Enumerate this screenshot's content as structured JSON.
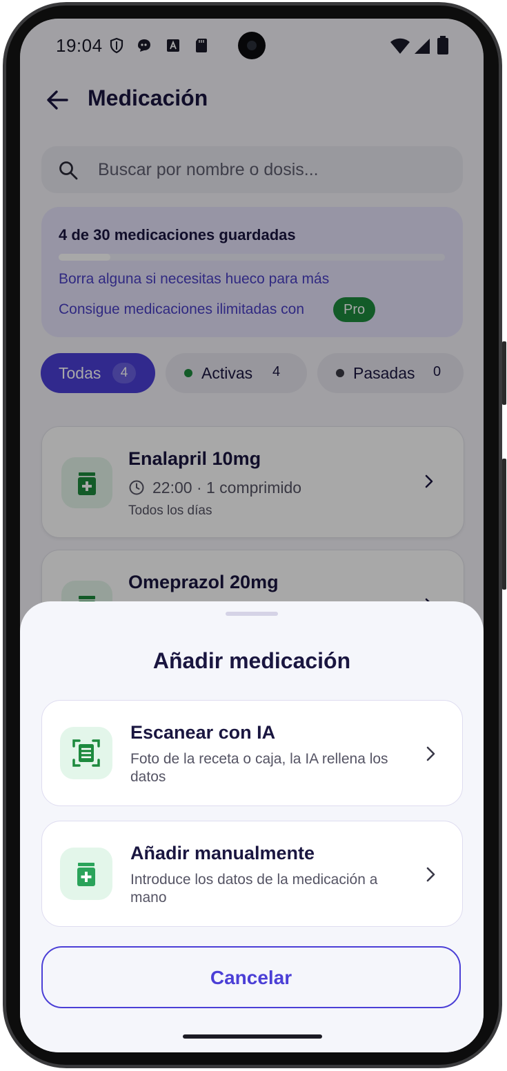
{
  "status_bar": {
    "time": "19:04"
  },
  "app_bar": {
    "title": "Medicación"
  },
  "search": {
    "placeholder": "Buscar por nombre o dosis..."
  },
  "quota": {
    "title": "4 de 30 medicaciones guardadas",
    "used": 4,
    "limit": 30,
    "delete_hint": "Borra alguna si necesitas hueco para más",
    "upsell_text": "Consigue medicaciones ilimitadas con",
    "pro_badge": "Pro"
  },
  "filters": [
    {
      "label": "Todas",
      "count": "4",
      "selected": true
    },
    {
      "label": "Activas",
      "count": "4",
      "dot_color": "#1d8a3e"
    },
    {
      "label": "Pasadas",
      "count": "0",
      "dot_color": "#3b3a45"
    }
  ],
  "medications": [
    {
      "name": "Enalapril 10mg",
      "dose": "22:00 · 1 comprimido",
      "frequency": "Todos los días",
      "icon": "pill-bottle-icon"
    },
    {
      "name": "Omeprazol 20mg",
      "icon": "pill-bottle-icon"
    }
  ],
  "sheet": {
    "title": "Añadir medicación",
    "options": [
      {
        "title": "Escanear con IA",
        "description": "Foto de la receta o caja, la IA rellena los datos",
        "icon": "scan-document-icon"
      },
      {
        "title": "Añadir manualmente",
        "description": "Introduce los datos de la medicación a mano",
        "icon": "pill-bottle-plus-icon"
      }
    ],
    "cancel_label": "Cancelar"
  },
  "colors": {
    "primary": "#4b3fd6",
    "green": "#1d8a3e",
    "text_dark": "#1a1640"
  }
}
